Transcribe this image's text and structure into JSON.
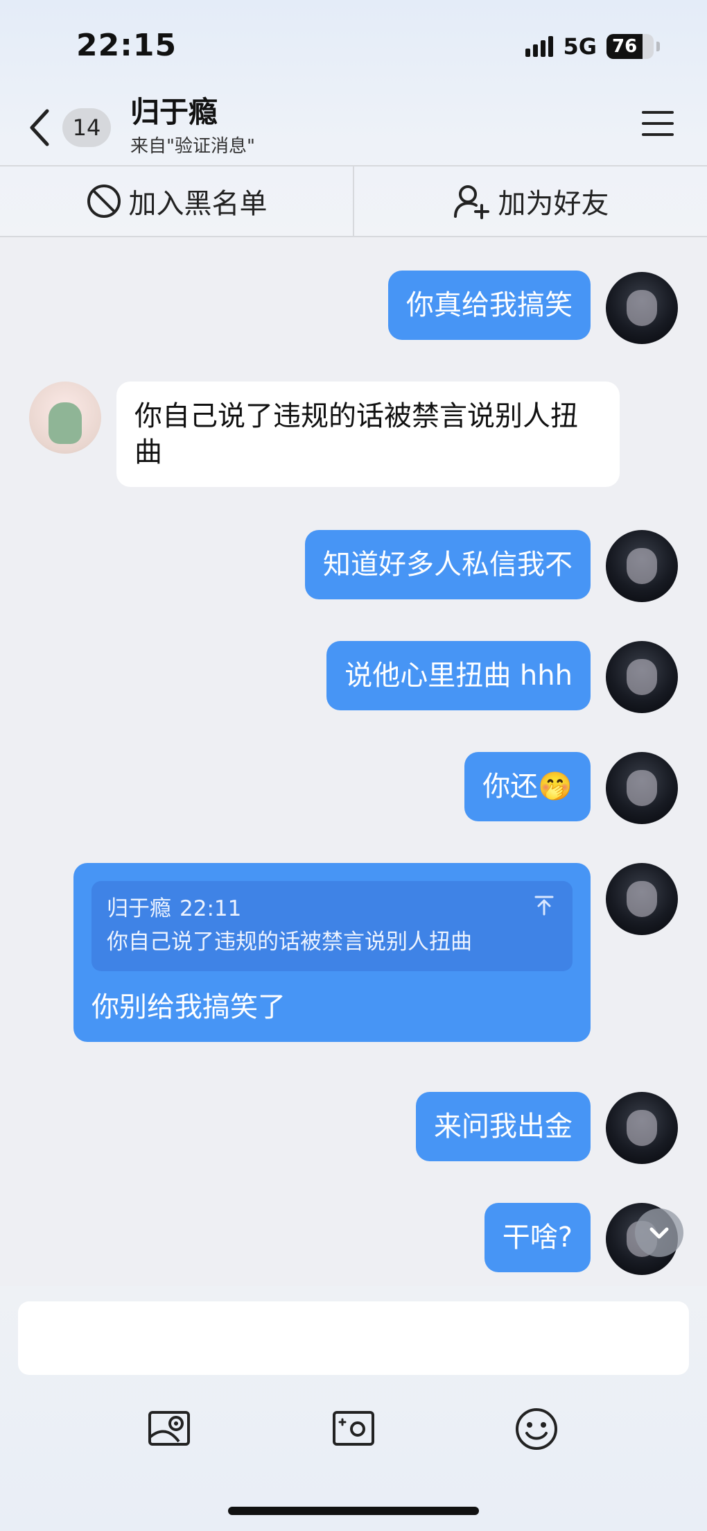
{
  "status_bar": {
    "time": "22:15",
    "network": "5G",
    "battery": "76",
    "battery_level": 0.76
  },
  "header": {
    "back_count": "14",
    "title": "归于瘾",
    "subtitle": "来自\"验证消息\""
  },
  "actions": {
    "block_label": "加入黑名单",
    "add_friend_label": "加为好友"
  },
  "messages": [
    {
      "sender": "me",
      "text": "你真给我搞笑"
    },
    {
      "sender": "other",
      "text": "你自己说了违规的话被禁言说别人扭曲"
    },
    {
      "sender": "me",
      "text": "知道好多人私信我不"
    },
    {
      "sender": "me",
      "text": "说他心里扭曲 hhh"
    },
    {
      "sender": "me",
      "text": "你还🤭"
    },
    {
      "sender": "me",
      "quote_name": "归于瘾",
      "quote_time": "22:11",
      "quote_text": "你自己说了违规的话被禁言说别人扭曲",
      "text": "你别给我搞笑了"
    },
    {
      "sender": "me",
      "text": "来问我出金"
    },
    {
      "sender": "me",
      "text": "干啥?"
    }
  ],
  "composer": {
    "value": "",
    "placeholder": ""
  },
  "toolbar": {
    "icons": [
      "image-icon",
      "camera-icon",
      "emoji-icon"
    ]
  },
  "colors": {
    "accent": "#4795f5",
    "quote_bg": "#3f83e6",
    "background": "#eeeff3"
  }
}
